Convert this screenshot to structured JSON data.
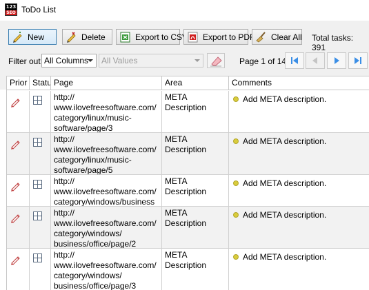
{
  "window": {
    "title": "ToDo List",
    "icon": "seo-123-app-icon"
  },
  "toolbar": {
    "new_label": "New",
    "delete_label": "Delete",
    "export_csv_label": "Export to CSV",
    "export_pdf_label": "Export to PDF",
    "clear_all_label": "Clear All",
    "total_tasks": "Total tasks: 391"
  },
  "filter": {
    "label": "Filter out",
    "column_value": "All Columns",
    "values_value": "All Values"
  },
  "pagination": {
    "label": "Page 1 of 14"
  },
  "table": {
    "headers": {
      "priority": "Prior",
      "status": "Statu",
      "page": "Page",
      "area": "Area",
      "comments": "Comments"
    },
    "rows": [
      {
        "page": [
          "http://",
          "www.ilovefreesoftware.com/",
          "category/linux/music-",
          "software/page/3"
        ],
        "area": [
          "META",
          "Description"
        ],
        "comment": "Add META description."
      },
      {
        "page": [
          "http://",
          "www.ilovefreesoftware.com/",
          "category/linux/music-",
          "software/page/5"
        ],
        "area": [
          "META",
          "Description"
        ],
        "comment": "Add META description."
      },
      {
        "page": [
          "http://",
          "www.ilovefreesoftware.com/",
          "category/windows/business"
        ],
        "area": [
          "META",
          "Description"
        ],
        "comment": "Add META description."
      },
      {
        "page": [
          "http://",
          "www.ilovefreesoftware.com/",
          "category/windows/",
          "business/office/page/2"
        ],
        "area": [
          "META",
          "Description"
        ],
        "comment": "Add META description."
      },
      {
        "page": [
          "http://",
          "www.ilovefreesoftware.com/",
          "category/windows/",
          "business/office/page/3"
        ],
        "area": [
          "META",
          "Description"
        ],
        "comment": "Add META description."
      }
    ]
  },
  "colors": {
    "accent": "#3c7fb1",
    "nav_arrow": "#3a8ee6",
    "status_dot": "#d9cc3c",
    "alt_row": "#f2f2f2"
  }
}
